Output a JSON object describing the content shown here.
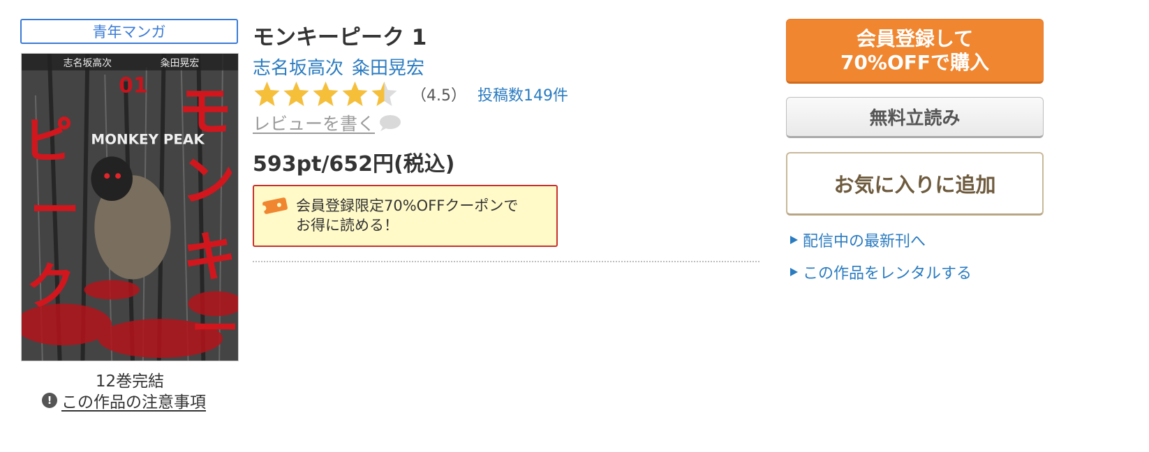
{
  "genre_tag": "青年マンガ",
  "cover": {
    "logo_text": "MONKEY PEAK",
    "vertical_title": "モンキーピーク",
    "volume_mark": "01",
    "credit_left": "志名坂高次",
    "credit_right": "粂田晃宏"
  },
  "volume_status": "12巻完結",
  "notice_link": "この作品の注意事項",
  "title": "モンキーピーク 1",
  "authors": [
    "志名坂高次",
    "粂田晃宏"
  ],
  "rating": {
    "value": 4.5,
    "max": 5,
    "score_text": "（4.5）",
    "post_count_text": "投稿数149件"
  },
  "write_review": "レビューを書く",
  "price": "593pt/652円(税込)",
  "coupon": {
    "line1": "会員登録限定70%OFFクーポンで",
    "line2": "お得に読める！"
  },
  "buttons": {
    "buy_line1": "会員登録して",
    "buy_line2": "70%OFFで購入",
    "free_read": "無料立読み",
    "favorite": "お気に入りに追加"
  },
  "links": {
    "latest": "配信中の最新刊へ",
    "rental": "この作品をレンタルする"
  },
  "colors": {
    "link_blue": "#2a7bc0",
    "buy_orange": "#f0862f",
    "star_gold": "#f6bf3a",
    "coupon_border": "#c9302c",
    "coupon_bg": "#fffac8"
  },
  "icons": [
    "exclamation-icon",
    "star-icon",
    "speech-bubble-icon",
    "coupon-ticket-icon",
    "triangle-right-icon"
  ]
}
